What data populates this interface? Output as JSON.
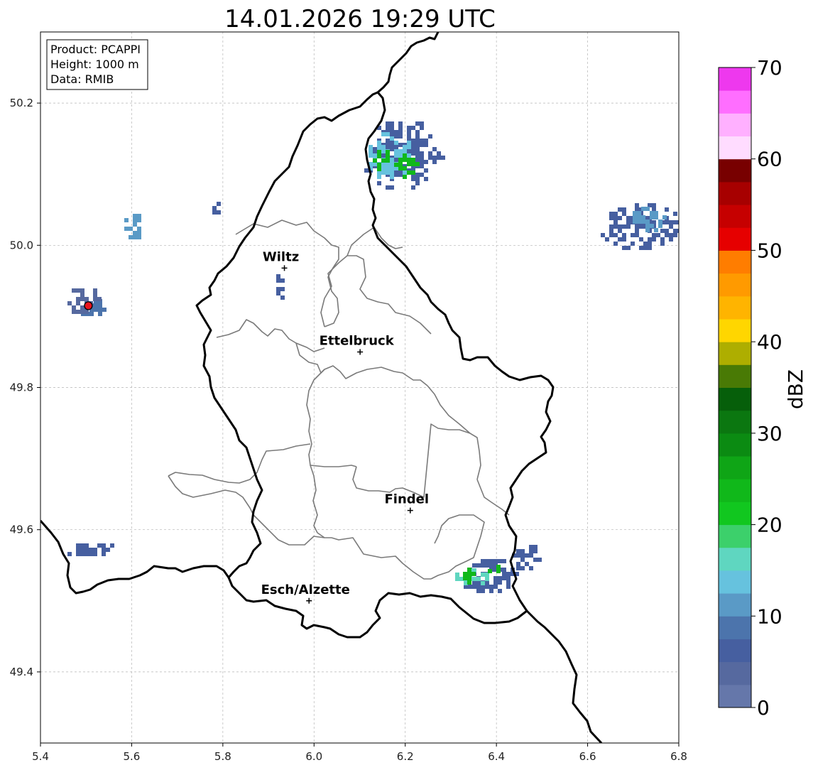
{
  "title": "14.01.2026 19:29 UTC",
  "info": {
    "product": "Product: PCAPPI",
    "height": "Height: 1000 m",
    "data": "Data: RMIB"
  },
  "map": {
    "lon_range": [
      5.4,
      6.8
    ],
    "lat_range": [
      49.3,
      50.3
    ],
    "x_ticks": [
      5.4,
      5.6,
      5.8,
      6.0,
      6.2,
      6.4,
      6.6,
      6.8
    ],
    "x_tick_labels": [
      "5.4",
      "5.6",
      "5.8",
      "6.0",
      "6.2",
      "6.4",
      "6.6",
      "6.8"
    ],
    "y_ticks": [
      49.4,
      49.6,
      49.8,
      50.0,
      50.2
    ],
    "y_tick_labels": [
      "49.4",
      "49.6",
      "49.8",
      "50.0",
      "50.2"
    ],
    "grid": true,
    "cities": [
      {
        "name": "Wiltz",
        "lon": 5.935,
        "lat": 49.968
      },
      {
        "name": "Ettelbruck",
        "lon": 6.101,
        "lat": 49.85
      },
      {
        "name": "Findel",
        "lon": 6.211,
        "lat": 49.627
      },
      {
        "name": "Esch/Alzette",
        "lon": 5.989,
        "lat": 49.5
      }
    ],
    "radar_site": {
      "lon": 5.505,
      "lat": 49.915,
      "color": "#e8141e"
    }
  },
  "colorbar": {
    "label": "dBZ",
    "min": 0,
    "max": 70,
    "step": 2.5,
    "ticks": [
      0,
      10,
      20,
      30,
      40,
      50,
      60,
      70
    ],
    "tick_labels": [
      "0",
      "10",
      "20",
      "30",
      "40",
      "50",
      "60",
      "70"
    ],
    "colors": [
      "#6577aa",
      "#56699f",
      "#465fa0",
      "#4c74ac",
      "#5a9ac6",
      "#66c2de",
      "#5fd6c0",
      "#3cd06b",
      "#11c71f",
      "#10b81a",
      "#0fa516",
      "#0b8b12",
      "#0b7710",
      "#065f0a",
      "#497a05",
      "#aeae00",
      "#ffd600",
      "#ffb400",
      "#ff9a00",
      "#ff7d00",
      "#e60000",
      "#c60000",
      "#a70000",
      "#780000",
      "#ffdcff",
      "#ffb0ff",
      "#ff6eff",
      "#ee38ee"
    ]
  },
  "echoes": [
    {
      "lon": 6.19,
      "lat": 50.13,
      "dlon": 0.09,
      "dlat": 0.05,
      "dbz": 6
    },
    {
      "lon": 6.16,
      "lat": 50.13,
      "dlon": 0.05,
      "dlat": 0.035,
      "dbz": 14
    },
    {
      "lon": 6.15,
      "lat": 50.12,
      "dlon": 0.03,
      "dlat": 0.02,
      "dbz": 24
    },
    {
      "lon": 6.2,
      "lat": 50.115,
      "dlon": 0.025,
      "dlat": 0.02,
      "dbz": 23
    },
    {
      "lon": 6.71,
      "lat": 50.03,
      "dlon": 0.09,
      "dlat": 0.035,
      "dbz": 6
    },
    {
      "lon": 6.73,
      "lat": 50.04,
      "dlon": 0.04,
      "dlat": 0.02,
      "dbz": 12
    },
    {
      "lon": 6.38,
      "lat": 49.54,
      "dlon": 0.07,
      "dlat": 0.025,
      "dbz": 7
    },
    {
      "lon": 6.34,
      "lat": 49.54,
      "dlon": 0.04,
      "dlat": 0.018,
      "dbz": 15
    },
    {
      "lon": 6.335,
      "lat": 49.54,
      "dlon": 0.018,
      "dlat": 0.013,
      "dbz": 24
    },
    {
      "lon": 6.39,
      "lat": 49.545,
      "dlon": 0.018,
      "dlat": 0.012,
      "dbz": 23
    },
    {
      "lon": 6.46,
      "lat": 49.565,
      "dlon": 0.035,
      "dlat": 0.02,
      "dbz": 6
    },
    {
      "lon": 5.51,
      "lat": 49.575,
      "dlon": 0.06,
      "dlat": 0.012,
      "dbz": 7
    },
    {
      "lon": 5.51,
      "lat": 49.915,
      "dlon": 0.03,
      "dlat": 0.015,
      "dbz": 8
    },
    {
      "lon": 5.49,
      "lat": 49.925,
      "dlon": 0.04,
      "dlat": 0.02,
      "dbz": 4
    },
    {
      "lon": 5.6,
      "lat": 50.03,
      "dlon": 0.025,
      "dlat": 0.02,
      "dbz": 10
    },
    {
      "lon": 5.78,
      "lat": 50.055,
      "dlon": 0.012,
      "dlat": 0.012,
      "dbz": 6
    },
    {
      "lon": 5.92,
      "lat": 49.945,
      "dlon": 0.012,
      "dlat": 0.02,
      "dbz": 6
    }
  ]
}
